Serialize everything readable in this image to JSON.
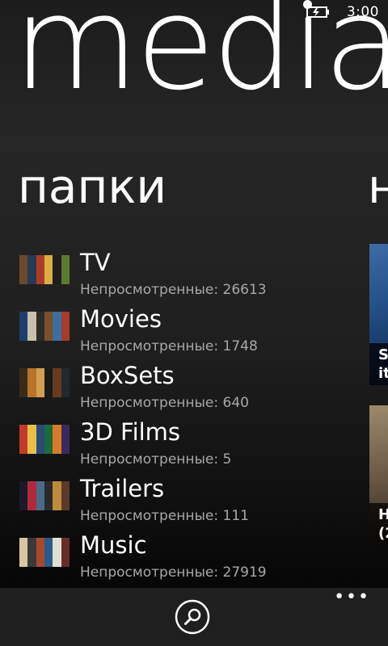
{
  "status_bar": {
    "time": "3:00",
    "icons": [
      "notification-dot-icon",
      "battery-charging-icon"
    ]
  },
  "title": "media",
  "sections": {
    "current_header": "папки",
    "next_header_peek": "н"
  },
  "folders": [
    {
      "name": "TV",
      "unwatched": "Непросмотренные: 26613",
      "thumb_colors": [
        "#6b4a2c",
        "#243a55",
        "#b03a2a",
        "#d9b040",
        "#1e1e1e",
        "#5a7a2e"
      ]
    },
    {
      "name": "Movies",
      "unwatched": "Непросмотренные: 1748",
      "thumb_colors": [
        "#1c3f6e",
        "#c8c0a8",
        "#2b2b2b",
        "#7a4f2a",
        "#3c6e9e",
        "#a83a2a"
      ]
    },
    {
      "name": "BoxSets",
      "unwatched": "Непросмотренные: 640",
      "thumb_colors": [
        "#3a2a1a",
        "#b8742a",
        "#d0a050",
        "#1a1a1a",
        "#6b3a1e",
        "#202830"
      ]
    },
    {
      "name": "3D Films",
      "unwatched": "Непросмотренные: 5",
      "thumb_colors": [
        "#c23a2a",
        "#e8c048",
        "#2a4a7a",
        "#1c6b3a",
        "#d87a2a",
        "#3a2a5a"
      ]
    },
    {
      "name": "Trailers",
      "unwatched": "Непросмотренные: 111",
      "thumb_colors": [
        "#1a1a2a",
        "#b02a3a",
        "#4a6a8a",
        "#2a2a2a",
        "#c08a3a",
        "#5a3a2a"
      ]
    },
    {
      "name": "Music",
      "unwatched": "Непросмотренные: 27919",
      "thumb_colors": [
        "#d8c8a0",
        "#3a3a3a",
        "#a84a2a",
        "#2a5a8a",
        "#e0e0d0",
        "#6a2a2a"
      ]
    }
  ],
  "peek_tiles": [
    {
      "caption": "S\nit"
    },
    {
      "caption": "H\n(2"
    }
  ],
  "app_bar": {
    "search_icon": "search-icon",
    "more_label": "•••"
  }
}
